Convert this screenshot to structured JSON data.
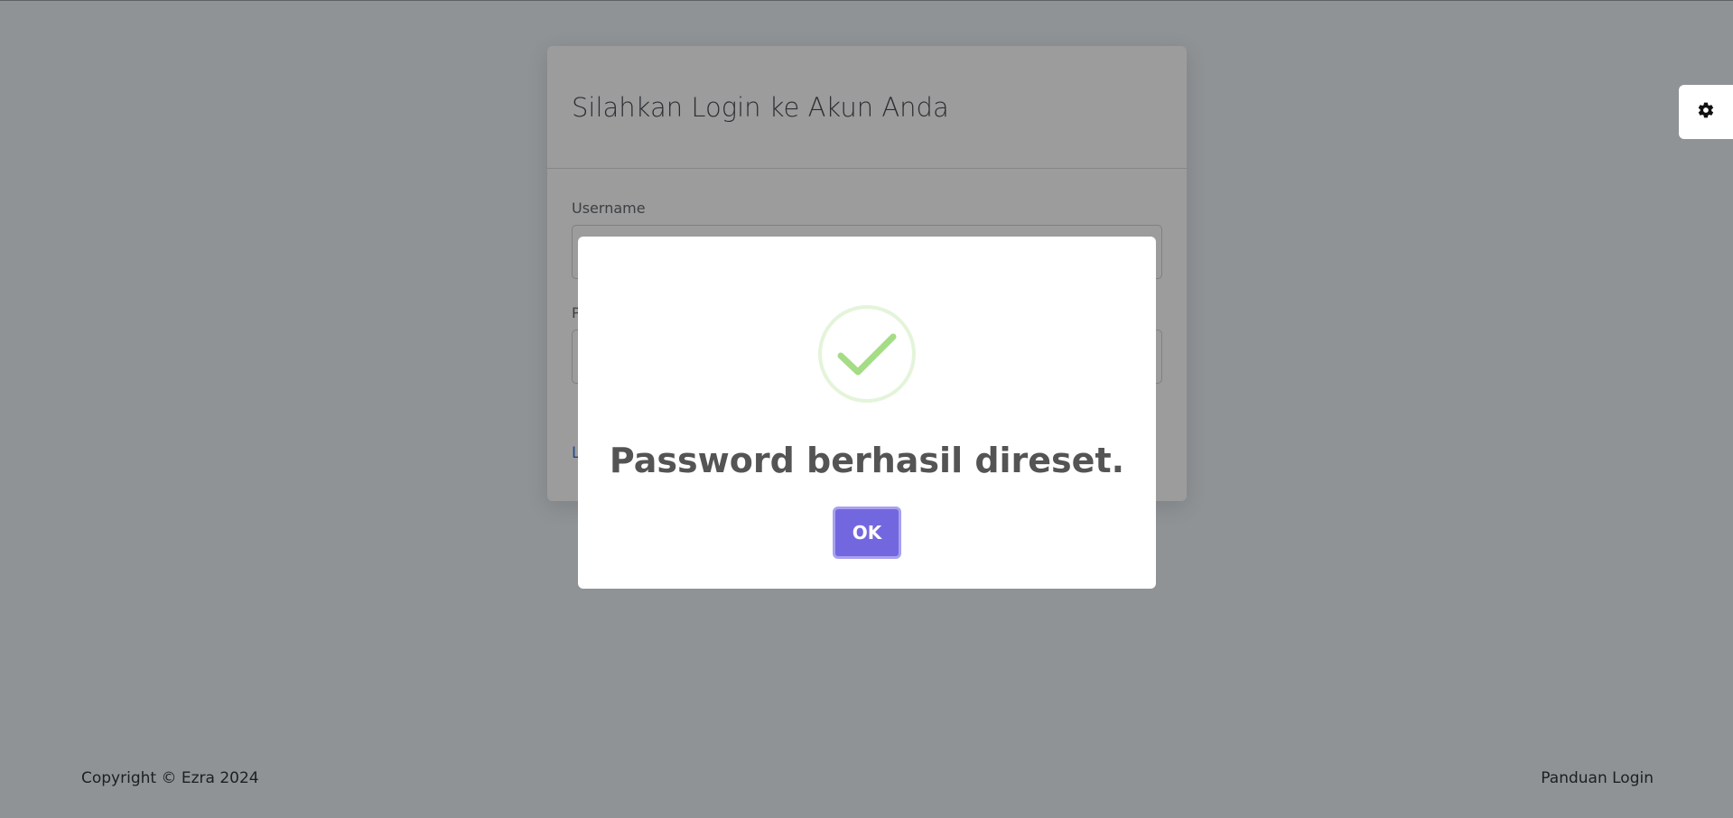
{
  "login_card": {
    "title": "Silahkan Login ke Akun Anda",
    "username_label": "Username",
    "password_label_visible": "P",
    "forgot_link_visible": "L"
  },
  "footer": {
    "copyright": "Copyright © Ezra 2024",
    "guide_link": "Panduan Login"
  },
  "settings": {
    "icon": "gear-icon"
  },
  "modal": {
    "icon": "success-check-icon",
    "message": "Password berhasil direset.",
    "ok_label": "OK",
    "colors": {
      "check": "#a5dc86",
      "ring": "rgba(165,220,134,0.3)",
      "button": "#7367e0"
    }
  },
  "colors": {
    "overlay_background": "#8f9396",
    "primary_button": "#1e4eb3"
  }
}
